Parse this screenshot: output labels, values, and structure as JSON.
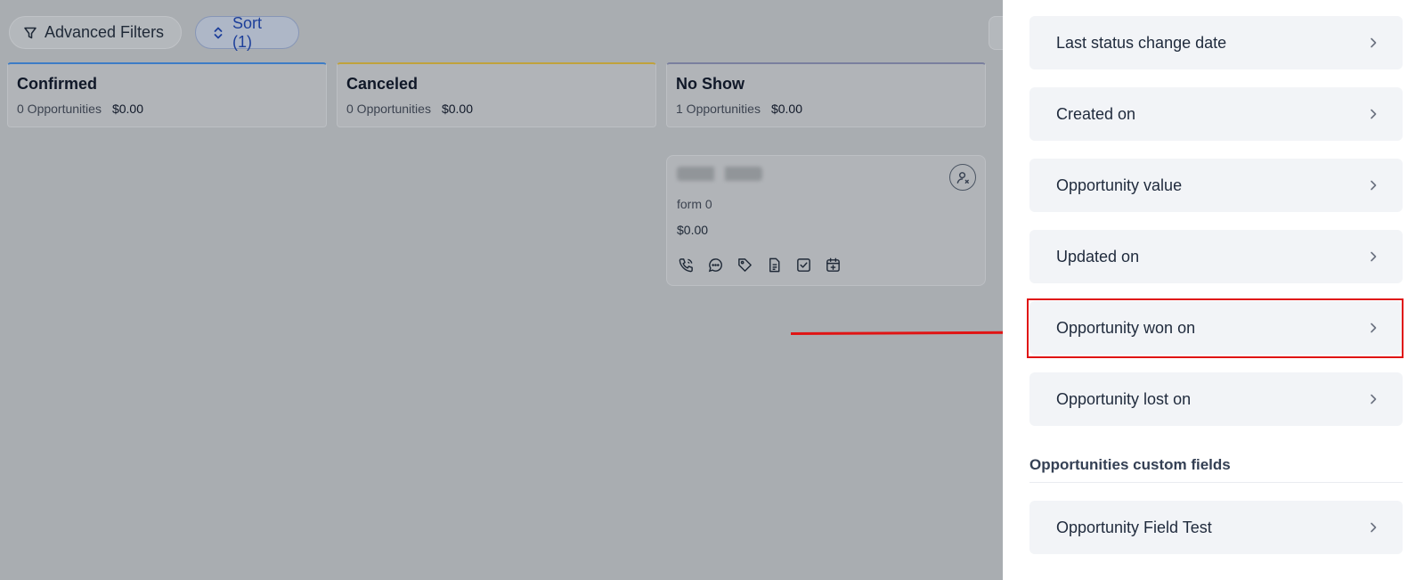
{
  "toolbar": {
    "advanced_filters_label": "Advanced Filters",
    "sort_label": "Sort (1)"
  },
  "columns": [
    {
      "name": "Confirmed",
      "count": "0 Opportunities",
      "value": "$0.00",
      "accent": "#3d7cc6"
    },
    {
      "name": "Canceled",
      "count": "0 Opportunities",
      "value": "$0.00",
      "accent": "#c0a23c"
    },
    {
      "name": "No Show",
      "count": "1 Opportunities",
      "value": "$0.00",
      "accent": "#7a7f9e"
    }
  ],
  "card": {
    "source": "form 0",
    "value": "$0.00",
    "icons": [
      "phone-icon",
      "chat-icon",
      "tag-icon",
      "note-icon",
      "task-icon",
      "calendar-add-icon"
    ]
  },
  "panel": {
    "options": [
      "Last status change date",
      "Created on",
      "Opportunity value",
      "Updated on",
      "Opportunity won on",
      "Opportunity lost on"
    ],
    "custom_fields_title": "Opportunities custom fields",
    "custom_fields": [
      "Opportunity Field Test"
    ],
    "highlighted_option": "Opportunity won on"
  },
  "colors": {
    "annotation": "#e01414",
    "sort_accent": "#1d3f9a"
  }
}
